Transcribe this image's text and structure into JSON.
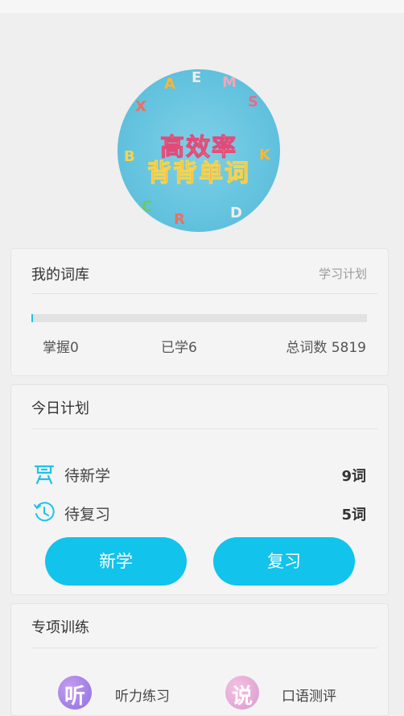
{
  "banner": {
    "line1": "高效率",
    "line2": "背背单词"
  },
  "library": {
    "title": "我的词库",
    "plan_link": "学习计划",
    "progress": 0.003,
    "mastered": "掌握0",
    "learned": "已学6",
    "total": "总词数 5819"
  },
  "today": {
    "title": "今日计划",
    "new_label": "待新学",
    "new_count": "9词",
    "review_label": "待复习",
    "review_count": "5词",
    "learn_button": "新学",
    "review_button": "复习"
  },
  "special": {
    "title": "专项训练",
    "listening_icon": "听",
    "listening_label": "听力练习",
    "speaking_icon": "说",
    "speaking_label": "口语测评"
  },
  "colors": {
    "accent": "#12c3ec",
    "background": "#efefef"
  }
}
